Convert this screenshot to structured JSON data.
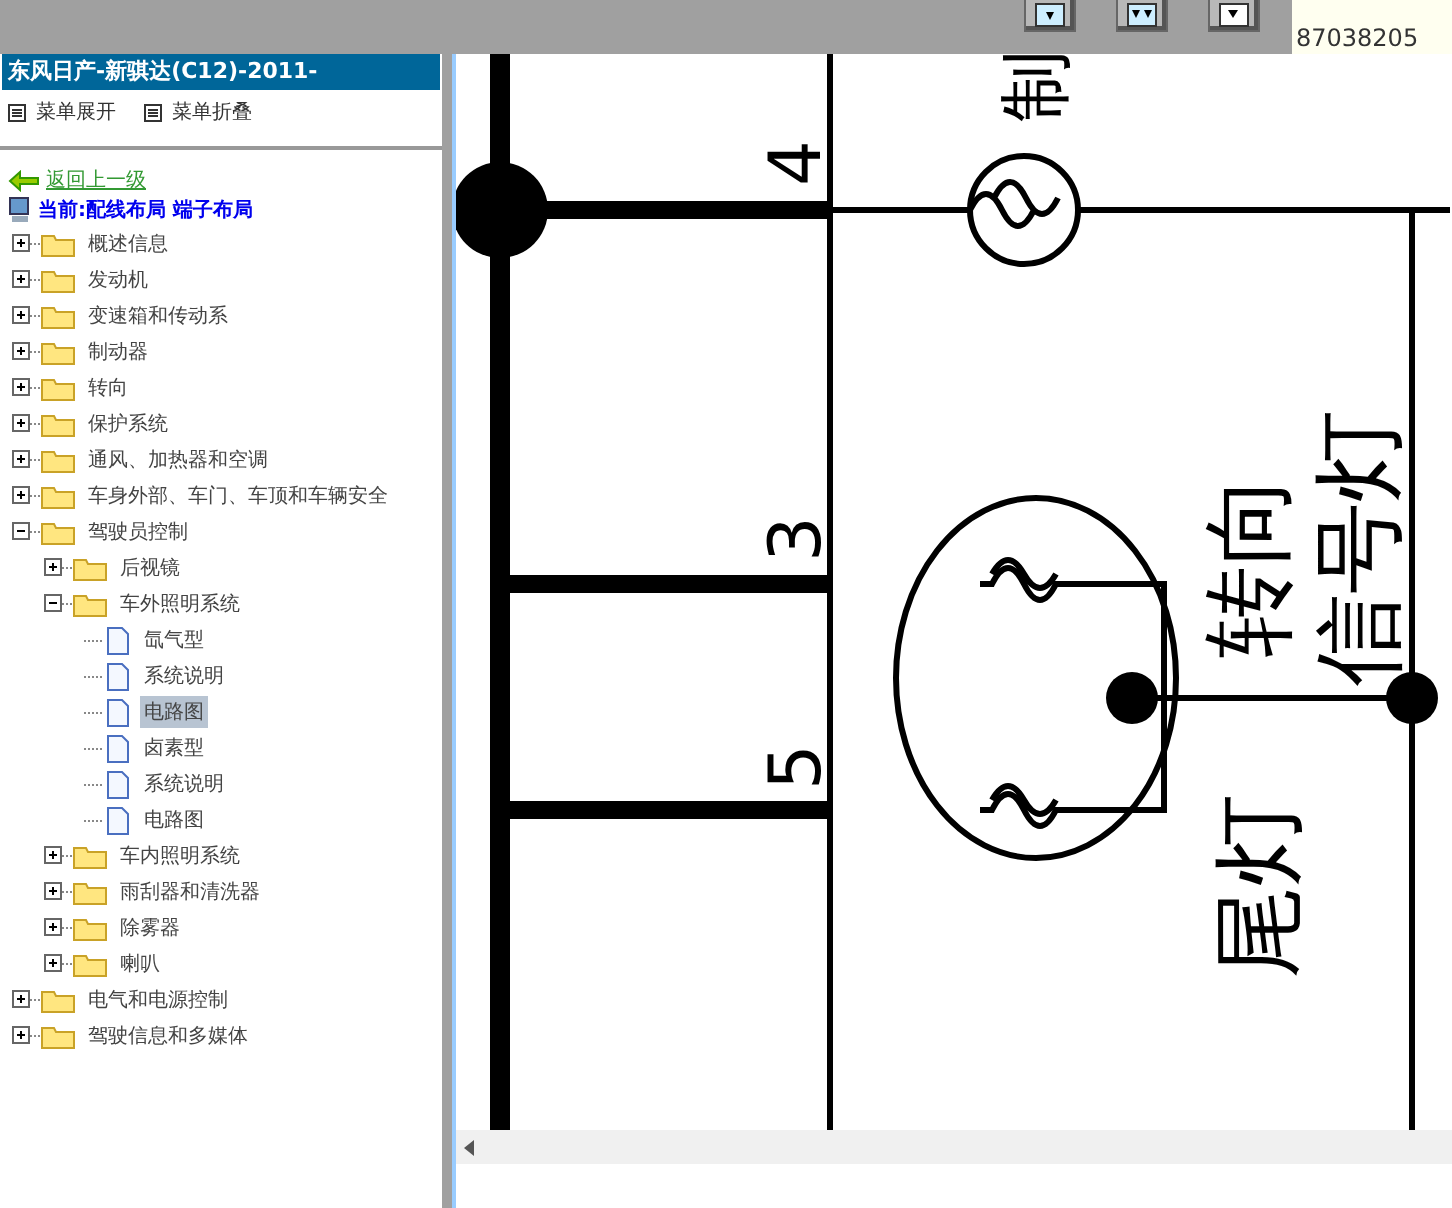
{
  "hotline": {
    "number": "87038205"
  },
  "sidebar": {
    "title": "东风日产-新骐达(C12)-2011-",
    "menu_actions": [
      "菜单展开",
      "菜单折叠"
    ],
    "back_link": "返回上一级",
    "current": "当前:配线布局 端子布局",
    "tree": [
      {
        "label": "概述信息",
        "kind": "folder",
        "expanded": false,
        "selected": false
      },
      {
        "label": "发动机",
        "kind": "folder",
        "expanded": false,
        "selected": false
      },
      {
        "label": "变速箱和传动系",
        "kind": "folder",
        "expanded": false,
        "selected": false
      },
      {
        "label": "制动器",
        "kind": "folder",
        "expanded": false,
        "selected": false
      },
      {
        "label": "转向",
        "kind": "folder",
        "expanded": false,
        "selected": false
      },
      {
        "label": "保护系统",
        "kind": "folder",
        "expanded": false,
        "selected": false
      },
      {
        "label": "通风、加热器和空调",
        "kind": "folder",
        "expanded": false,
        "selected": false
      },
      {
        "label": "车身外部、车门、车顶和车辆安全",
        "kind": "folder",
        "expanded": false,
        "selected": false
      },
      {
        "label": "驾驶员控制",
        "kind": "folder",
        "expanded": true,
        "selected": false,
        "children": [
          {
            "label": "后视镜",
            "kind": "folder",
            "expanded": false,
            "selected": false
          },
          {
            "label": "车外照明系统",
            "kind": "folder",
            "expanded": true,
            "selected": false,
            "children": [
              {
                "label": "氙气型",
                "kind": "page",
                "selected": false
              },
              {
                "label": "系统说明",
                "kind": "page",
                "selected": false
              },
              {
                "label": "电路图",
                "kind": "page",
                "selected": true
              },
              {
                "label": "卤素型",
                "kind": "page",
                "selected": false
              },
              {
                "label": "系统说明",
                "kind": "page",
                "selected": false
              },
              {
                "label": "电路图",
                "kind": "page",
                "selected": false
              }
            ]
          },
          {
            "label": "车内照明系统",
            "kind": "folder",
            "expanded": false,
            "selected": false
          },
          {
            "label": "雨刮器和清洗器",
            "kind": "folder",
            "expanded": false,
            "selected": false
          },
          {
            "label": "除雾器",
            "kind": "folder",
            "expanded": false,
            "selected": false
          },
          {
            "label": "喇叭",
            "kind": "folder",
            "expanded": false,
            "selected": false
          }
        ]
      },
      {
        "label": "电气和电源控制",
        "kind": "folder",
        "expanded": false,
        "selected": false
      },
      {
        "label": "驾驶信息和多媒体",
        "kind": "folder",
        "expanded": false,
        "selected": false
      }
    ]
  },
  "diagram": {
    "pins": [
      "4",
      "3",
      "5"
    ],
    "top_lamp": "制",
    "turn_signal": [
      "转向",
      "信号灯"
    ],
    "tail_lamp": "尾灯"
  }
}
